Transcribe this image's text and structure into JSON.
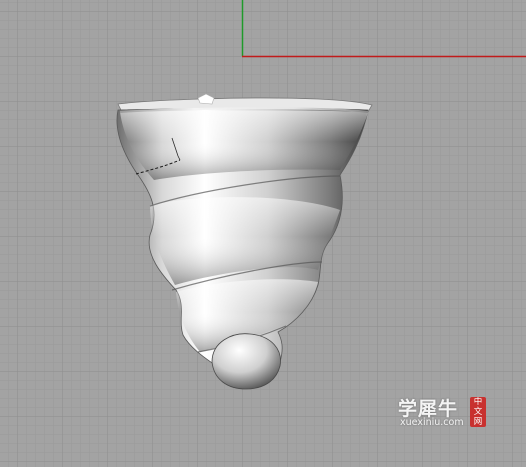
{
  "viewport": {
    "background": "#a3a3a3",
    "grid_minor_color": "#9a9a9a",
    "grid_major_color": "#8c8c8c",
    "x_axis_color": "#c11b1b",
    "y_axis_color": "#1f9a2a",
    "model": "spiral-shell-surface"
  },
  "watermark": {
    "chinese_text": "学犀牛",
    "url": "xuexiniu.com",
    "badge_chars": [
      "中",
      "文",
      "网"
    ],
    "badge_color": "#c8312f"
  }
}
